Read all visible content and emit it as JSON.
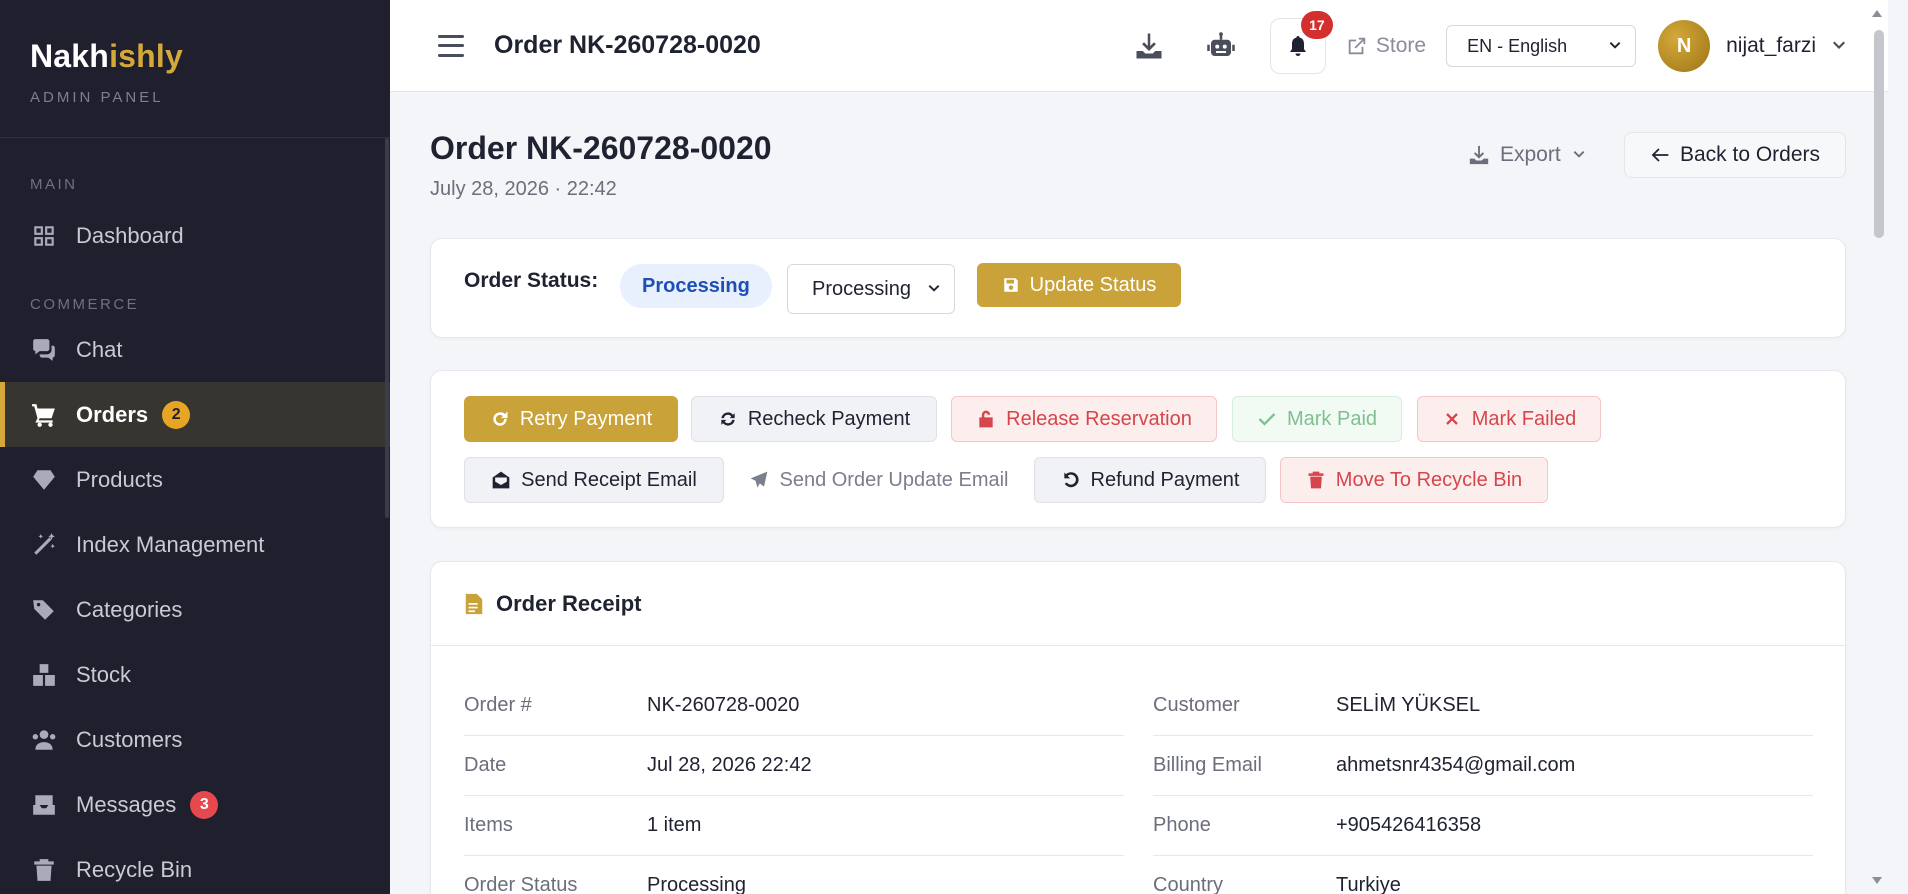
{
  "brand": {
    "name_part1": "Nakh",
    "name_part2": "ishly",
    "subtitle": "ADMIN PANEL"
  },
  "sidebar": {
    "sections": {
      "main": "MAIN",
      "commerce": "COMMERCE"
    },
    "items": [
      {
        "label": "Dashboard",
        "icon": "dashboard-icon"
      },
      {
        "label": "Chat",
        "icon": "chat-icon"
      },
      {
        "label": "Orders",
        "icon": "cart-icon",
        "badge": "2",
        "active": true
      },
      {
        "label": "Products",
        "icon": "gem-icon"
      },
      {
        "label": "Index Management",
        "icon": "wand-icon"
      },
      {
        "label": "Categories",
        "icon": "tags-icon"
      },
      {
        "label": "Stock",
        "icon": "boxes-icon"
      },
      {
        "label": "Customers",
        "icon": "users-icon"
      },
      {
        "label": "Messages",
        "icon": "inbox-icon",
        "badge": "3"
      },
      {
        "label": "Recycle Bin",
        "icon": "trash-icon"
      }
    ]
  },
  "topbar": {
    "title": "Order NK-260728-0020",
    "notifications_count": "17",
    "store_label": "Store",
    "language": "EN - English",
    "avatar_initial": "N",
    "username": "nijat_farzi"
  },
  "page": {
    "title": "Order NK-260728-0020",
    "date": "July 28, 2026 · 22:42",
    "export_label": "Export",
    "back_label": "Back to Orders"
  },
  "status": {
    "label": "Order Status:",
    "current": "Processing",
    "select_value": "Processing",
    "update_label": "Update Status"
  },
  "actions": {
    "retry_payment": "Retry Payment",
    "recheck_payment": "Recheck Payment",
    "release_reservation": "Release Reservation",
    "mark_paid": "Mark Paid",
    "mark_failed": "Mark Failed",
    "send_receipt_email": "Send Receipt Email",
    "send_order_update_email": "Send Order Update Email",
    "refund_payment": "Refund Payment",
    "move_to_recycle_bin": "Move To Recycle Bin"
  },
  "receipt": {
    "title": "Order Receipt",
    "left": [
      {
        "key": "Order #",
        "value": "NK-260728-0020"
      },
      {
        "key": "Date",
        "value": "Jul 28, 2026 22:42"
      },
      {
        "key": "Items",
        "value": "1 item"
      },
      {
        "key": "Order Status",
        "value": "Processing"
      }
    ],
    "right": [
      {
        "key": "Customer",
        "value": "SELİM YÜKSEL"
      },
      {
        "key": "Billing Email",
        "value": "ahmetsnr4354@gmail.com"
      },
      {
        "key": "Phone",
        "value": "+905426416358"
      },
      {
        "key": "Country",
        "value": "Turkiye"
      }
    ]
  },
  "colors": {
    "accent": "#c9a23a",
    "sidebar_bg": "#1f1f2e",
    "status_blue": "#1e4fb5",
    "danger": "#d6454b"
  }
}
